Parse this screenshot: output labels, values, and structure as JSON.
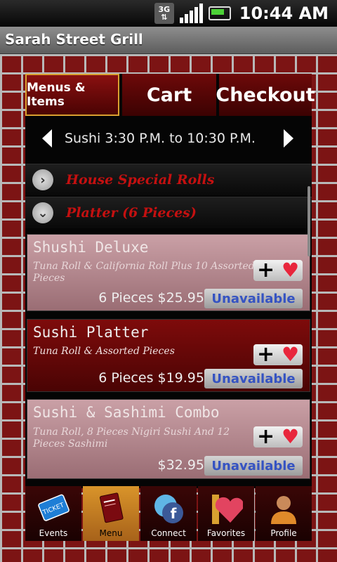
{
  "status_bar": {
    "network": "3G",
    "time": "10:44 AM"
  },
  "app": {
    "title": "Sarah Street Grill"
  },
  "tabs": [
    {
      "label": "Menus & Items",
      "active": true
    },
    {
      "label": "Cart",
      "active": false
    },
    {
      "label": "Checkout",
      "active": false
    }
  ],
  "schedule": {
    "text": "Sushi 3:30 P.M.  to 10:30 P.M."
  },
  "categories": [
    {
      "label": "House Special Rolls",
      "expanded": false
    },
    {
      "label": "Platter (6 Pieces)",
      "expanded": true
    }
  ],
  "items": [
    {
      "name": "Shushi Deluxe",
      "description": "Tuna Roll & California Roll Plus 10 Assorted Pieces",
      "price": "6 Pieces $25.95",
      "status": "Unavailable",
      "available": false
    },
    {
      "name": "Sushi Platter",
      "description": "Tuna Roll & Assorted Pieces",
      "price": "6 Pieces $19.95",
      "status": "Unavailable",
      "available": true
    },
    {
      "name": "Sushi & Sashimi Combo",
      "description": "Tuna Roll, 8 Pieces Nigiri Sushi And 12 Pieces Sashimi",
      "price": "$32.95",
      "status": "Unavailable",
      "available": false
    }
  ],
  "bottom_nav": [
    {
      "label": "Events",
      "icon": "ticket-icon"
    },
    {
      "label": "Menu",
      "icon": "menu-book-icon",
      "active": true
    },
    {
      "label": "Connect",
      "icon": "social-connect-icon"
    },
    {
      "label": "Favorites",
      "icon": "heart-bookmark-icon"
    },
    {
      "label": "Profile",
      "icon": "profile-person-icon"
    }
  ],
  "colors": {
    "brand": "#6e0909",
    "accent": "#d9942a",
    "category_text": "#c41010",
    "status_link": "#3553c2"
  }
}
